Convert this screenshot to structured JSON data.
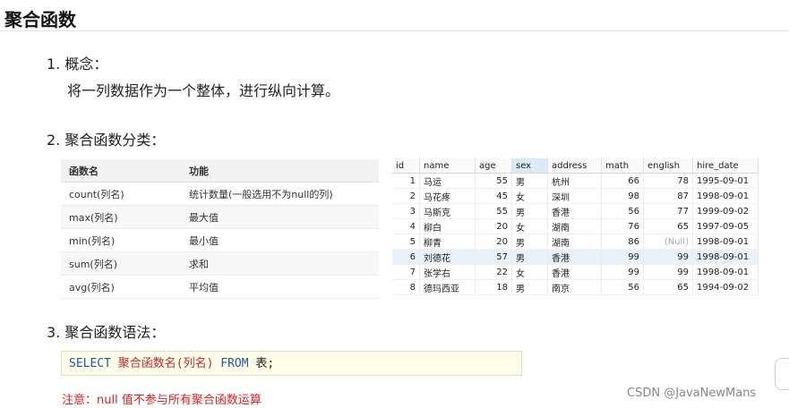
{
  "page": {
    "title": "聚合函数",
    "s1_heading": "1.  概念：",
    "s1_text": "将一列数据作为一个整体，进行纵向计算。",
    "s2_heading": "2. 聚合函数分类：",
    "s3_heading": "3. 聚合函数语法：",
    "code": {
      "select": "SELECT",
      "func": "聚合函数名(列名)",
      "from": "FROM",
      "table": "表;"
    },
    "note": "注意：null 值不参与所有聚合函数运算",
    "watermark": "CSDN @JavaNewMans"
  },
  "func_table": {
    "headers": [
      "函数名",
      "功能"
    ],
    "rows": [
      [
        "count(列名)",
        "统计数量(一般选用不为null的列)"
      ],
      [
        "max(列名)",
        "最大值"
      ],
      [
        "min(列名)",
        "最小值"
      ],
      [
        "sum(列名)",
        "求和"
      ],
      [
        "avg(列名)",
        "平均值"
      ]
    ]
  },
  "grid": {
    "headers": [
      "id",
      "name",
      "age",
      "sex",
      "address",
      "math",
      "english",
      "hire_date"
    ],
    "rows": [
      [
        "1",
        "马运",
        "55",
        "男",
        "杭州",
        "66",
        "78",
        "1995-09-01"
      ],
      [
        "2",
        "马花疼",
        "45",
        "女",
        "深圳",
        "98",
        "87",
        "1998-09-01"
      ],
      [
        "3",
        "马斯克",
        "55",
        "男",
        "香港",
        "56",
        "77",
        "1999-09-02"
      ],
      [
        "4",
        "柳白",
        "20",
        "女",
        "湖南",
        "76",
        "65",
        "1997-09-05"
      ],
      [
        "5",
        "柳青",
        "20",
        "男",
        "湖南",
        "86",
        "(Null)",
        "1998-09-01"
      ],
      [
        "6",
        "刘德花",
        "57",
        "男",
        "香港",
        "99",
        "99",
        "1998-09-01"
      ],
      [
        "7",
        "张学右",
        "22",
        "女",
        "香港",
        "99",
        "99",
        "1998-09-01"
      ],
      [
        "8",
        "德玛西亚",
        "18",
        "男",
        "南京",
        "56",
        "65",
        "1994-09-02"
      ]
    ],
    "selected_column": "sex",
    "highlighted_row": "6"
  }
}
